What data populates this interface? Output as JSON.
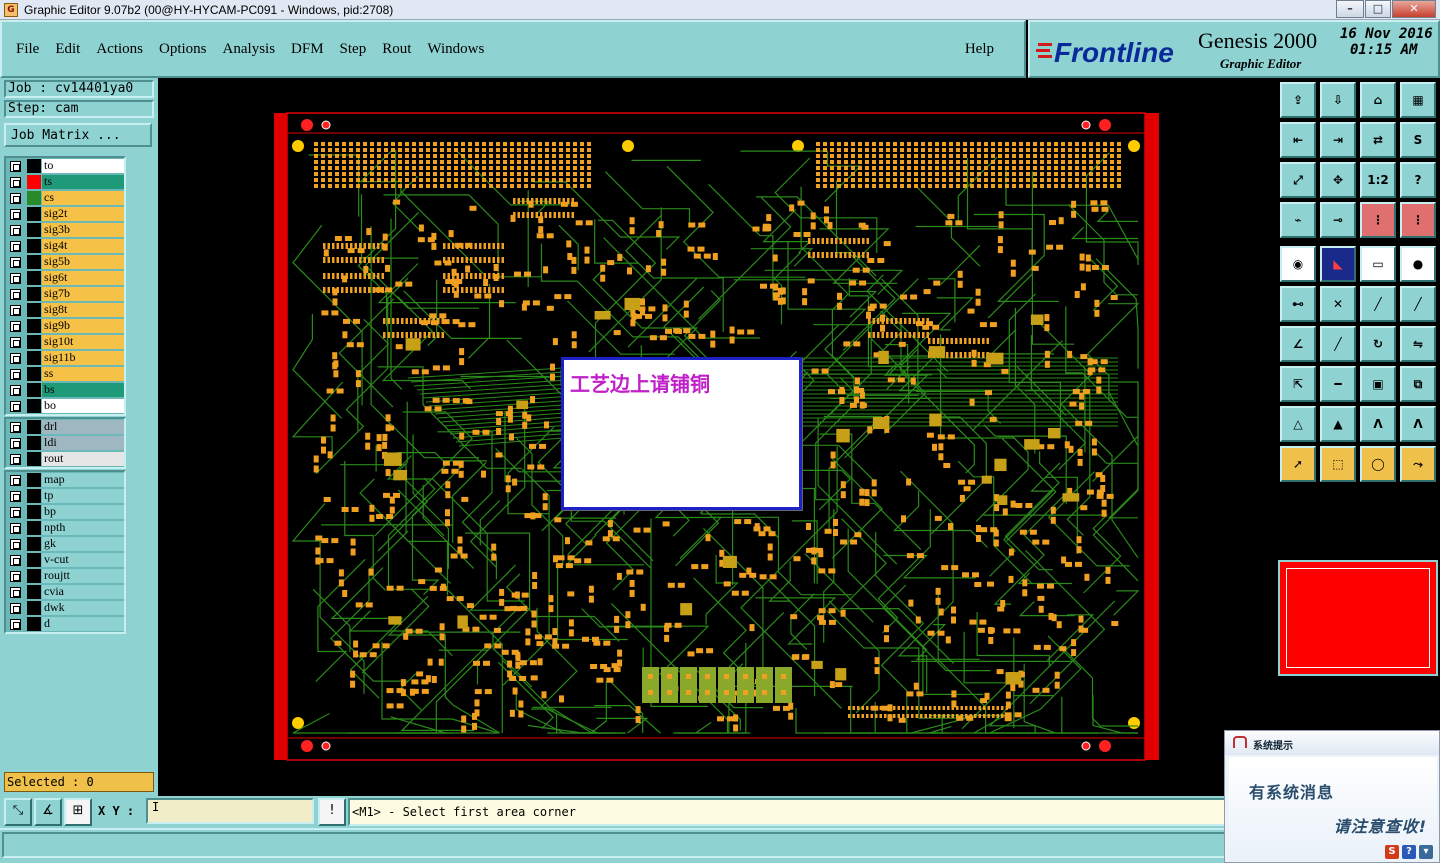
{
  "window": {
    "title": "Graphic Editor 9.07b2 (00@HY-HYCAM-PC091 - Windows, pid:2708)",
    "app_icon": "genesis-icon"
  },
  "menu": {
    "items": [
      "File",
      "Edit",
      "Actions",
      "Options",
      "Analysis",
      "DFM",
      "Step",
      "Rout",
      "Windows"
    ],
    "help": "Help"
  },
  "brand": {
    "logo": "Frontline",
    "product": "Genesis 2000",
    "subtitle": "Graphic Editor",
    "date": "16 Nov 2016",
    "time": "01:15 AM"
  },
  "job": {
    "job_label": "Job : cv14401ya0",
    "step_label": "Step: cam",
    "matrix_button": "Job Matrix ..."
  },
  "layers": {
    "board": [
      {
        "name": "to",
        "color": "#ffffff",
        "swatch": "#000000"
      },
      {
        "name": "ts",
        "color": "#1f9a78",
        "swatch": "#ff0000",
        "active": true
      },
      {
        "name": "cs",
        "color": "#f5c146",
        "swatch": "#2a8a2a"
      },
      {
        "name": "sig2t",
        "color": "#f5c146",
        "swatch": "#000000"
      },
      {
        "name": "sig3b",
        "color": "#f5c146",
        "swatch": "#000000"
      },
      {
        "name": "sig4t",
        "color": "#f5c146",
        "swatch": "#000000"
      },
      {
        "name": "sig5b",
        "color": "#f5c146",
        "swatch": "#000000"
      },
      {
        "name": "sig6t",
        "color": "#f5c146",
        "swatch": "#000000"
      },
      {
        "name": "sig7b",
        "color": "#f5c146",
        "swatch": "#000000"
      },
      {
        "name": "sig8t",
        "color": "#f5c146",
        "swatch": "#000000"
      },
      {
        "name": "sig9b",
        "color": "#f5c146",
        "swatch": "#000000"
      },
      {
        "name": "sig10t",
        "color": "#f5c146",
        "swatch": "#000000"
      },
      {
        "name": "sig11b",
        "color": "#f5c146",
        "swatch": "#000000"
      },
      {
        "name": "ss",
        "color": "#f5c146",
        "swatch": "#000000"
      },
      {
        "name": "bs",
        "color": "#1f9a78",
        "swatch": "#000000"
      },
      {
        "name": "bo",
        "color": "#ffffff",
        "swatch": "#000000"
      }
    ],
    "drill": [
      {
        "name": "drl",
        "color": "#9eb7c0",
        "swatch": "#000000"
      },
      {
        "name": "ldi",
        "color": "#9eb7c0",
        "swatch": "#000000"
      },
      {
        "name": "rout",
        "color": "#e6e6e6",
        "swatch": "#000000"
      }
    ],
    "misc": [
      {
        "name": "map",
        "color": "#8fd2d2",
        "swatch": "#000000"
      },
      {
        "name": "tp",
        "color": "#8fd2d2",
        "swatch": "#000000"
      },
      {
        "name": "bp",
        "color": "#8fd2d2",
        "swatch": "#000000"
      },
      {
        "name": "npth",
        "color": "#8fd2d2",
        "swatch": "#000000"
      },
      {
        "name": "gk",
        "color": "#8fd2d2",
        "swatch": "#000000"
      },
      {
        "name": "v-cut",
        "color": "#8fd2d2",
        "swatch": "#000000"
      },
      {
        "name": "roujtt",
        "color": "#8fd2d2",
        "swatch": "#000000"
      },
      {
        "name": "cvia",
        "color": "#8fd2d2",
        "swatch": "#000000"
      },
      {
        "name": "dwk",
        "color": "#8fd2d2",
        "swatch": "#000000"
      },
      {
        "name": "d",
        "color": "#8fd2d2",
        "swatch": "#000000"
      }
    ]
  },
  "selection": {
    "text": "Selected : 0"
  },
  "toolbox": {
    "rows": [
      [
        {
          "icon": "home-icon",
          "glyph": "⇪",
          "bg": "#8fd2d2"
        },
        {
          "icon": "zoom-home-icon",
          "glyph": "⇩",
          "bg": "#8fd2d2"
        },
        {
          "icon": "house-icon",
          "glyph": "⌂",
          "bg": "#8fd2d2"
        },
        {
          "icon": "window-icon",
          "glyph": "▦",
          "bg": "#8fd2d2"
        }
      ],
      [
        {
          "icon": "pan-left-icon",
          "glyph": "⇤",
          "bg": "#8fd2d2"
        },
        {
          "icon": "pan-right-icon",
          "glyph": "⇥",
          "bg": "#8fd2d2"
        },
        {
          "icon": "swap-icon",
          "glyph": "⇄",
          "bg": "#8fd2d2"
        },
        {
          "icon": "snake-icon",
          "glyph": "S",
          "bg": "#8fd2d2"
        }
      ],
      [
        {
          "icon": "fit-icon",
          "glyph": "⤢",
          "bg": "#8fd2d2"
        },
        {
          "icon": "center-icon",
          "glyph": "✥",
          "bg": "#8fd2d2"
        },
        {
          "icon": "scale-icon",
          "glyph": "1:2",
          "bg": "#8fd2d2"
        },
        {
          "icon": "help-icon",
          "glyph": "?",
          "bg": "#8fd2d2"
        }
      ],
      [
        {
          "icon": "snap-icon",
          "glyph": "⌁",
          "bg": "#8fd2d2"
        },
        {
          "icon": "key-icon",
          "glyph": "⊸",
          "bg": "#8fd2d2"
        },
        {
          "icon": "network-icon",
          "glyph": "⋮",
          "bg": "#e07070"
        },
        {
          "icon": "network-alt-icon",
          "glyph": "⋮",
          "bg": "#e07070"
        }
      ],
      [
        {
          "icon": "select-icon",
          "glyph": "◉",
          "bg": "#ffffff"
        },
        {
          "icon": "measure-icon",
          "glyph": "◣",
          "bg": "#1a2a8a"
        },
        {
          "icon": "ruler-icon",
          "glyph": "▭",
          "bg": "#ffffff"
        },
        {
          "icon": "pad-icon",
          "glyph": "●",
          "bg": "#ffffff"
        }
      ],
      [
        {
          "icon": "connect-icon",
          "glyph": "⊷",
          "bg": "#8fd2d2"
        },
        {
          "icon": "cross-icon",
          "glyph": "✕",
          "bg": "#8fd2d2"
        },
        {
          "icon": "line-icon",
          "glyph": "╱",
          "bg": "#8fd2d2"
        },
        {
          "icon": "line-alt-icon",
          "glyph": "╱",
          "bg": "#8fd2d2"
        }
      ],
      [
        {
          "icon": "angle-icon",
          "glyph": "∠",
          "bg": "#8fd2d2"
        },
        {
          "icon": "slash-icon",
          "glyph": "╱",
          "bg": "#8fd2d2"
        },
        {
          "icon": "arc-icon",
          "glyph": "↻",
          "bg": "#8fd2d2"
        },
        {
          "icon": "mirror-icon",
          "glyph": "⇋",
          "bg": "#8fd2d2"
        }
      ],
      [
        {
          "icon": "move-icon",
          "glyph": "⇱",
          "bg": "#8fd2d2"
        },
        {
          "icon": "minus-icon",
          "glyph": "━",
          "bg": "#8fd2d2"
        },
        {
          "icon": "box-icon",
          "glyph": "▣",
          "bg": "#8fd2d2"
        },
        {
          "icon": "group-icon",
          "glyph": "⧉",
          "bg": "#8fd2d2"
        }
      ],
      [
        {
          "icon": "triangle-icon",
          "glyph": "△",
          "bg": "#8fd2d2"
        },
        {
          "icon": "triangle-up-icon",
          "glyph": "▲",
          "bg": "#8fd2d2"
        },
        {
          "icon": "arrow-a-icon",
          "glyph": "Λ",
          "bg": "#8fd2d2"
        },
        {
          "icon": "arrow-a-alt-icon",
          "glyph": "Λ",
          "bg": "#8fd2d2"
        }
      ],
      [
        {
          "icon": "pointer-icon",
          "glyph": "➚",
          "bg": "#f0c14a"
        },
        {
          "icon": "pointer-box-icon",
          "glyph": "⬚",
          "bg": "#f0c14a"
        },
        {
          "icon": "pointer-circle-icon",
          "glyph": "◯",
          "bg": "#f0c14a"
        },
        {
          "icon": "pointer-route-icon",
          "glyph": "⤳",
          "bg": "#f0c14a"
        }
      ]
    ]
  },
  "coords": {
    "label": "X Y :",
    "value": "",
    "cursor": "I"
  },
  "status_message": "<M1> - Select first area corner",
  "popup": {
    "text": "工艺边上请铺铜"
  },
  "toast": {
    "title": "系统提示",
    "line1": "有系统消息",
    "line2": "请注意查收!"
  },
  "colors": {
    "panel": "#8fd2d2",
    "board_frame": "#e10000",
    "trace": "#2a8a1a",
    "pad": "#f0a020",
    "fiducial": "#ffcc00"
  }
}
